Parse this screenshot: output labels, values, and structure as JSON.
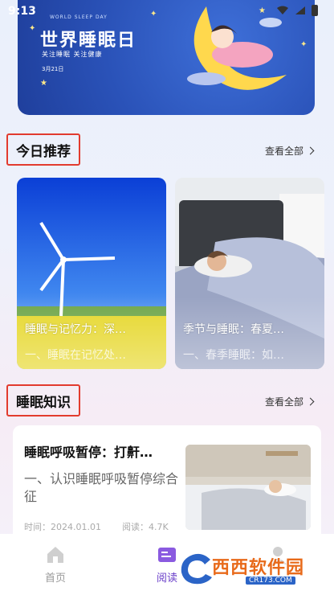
{
  "status_bar": {
    "time": "9:13"
  },
  "banner": {
    "subtitle_en": "WORLD SLEEP DAY",
    "title": "世界睡眠日",
    "tagline": "关注睡眠  关注健康",
    "date": "3月21日"
  },
  "recommend": {
    "title": "今日推荐",
    "view_all": "查看全部",
    "cards": [
      {
        "title": "睡眠与记忆力：深…",
        "desc": "一、睡眠在记忆处…"
      },
      {
        "title": "季节与睡眠：春夏…",
        "desc": "一、春季睡眠：如…"
      }
    ]
  },
  "knowledge": {
    "title": "睡眠知识",
    "view_all": "查看全部",
    "article": {
      "title": "睡眠呼吸暂停：打鼾…",
      "desc": "一、认识睡眠呼吸暂停综合征",
      "time_label": "时间：2024.01.01",
      "read_label": "阅读：4.7K"
    }
  },
  "bottom_nav": {
    "items": [
      {
        "label": "首页",
        "icon": "home-icon"
      },
      {
        "label": "阅读",
        "icon": "book-icon"
      },
      {
        "label": "",
        "icon": "profile-icon"
      }
    ]
  },
  "watermark": {
    "text": "西西软件园",
    "domain": "CR173.COM"
  },
  "colors": {
    "highlight_box": "#e23b2e",
    "active_nav": "#6a3fc9",
    "banner_blue": "#2a52b8"
  }
}
